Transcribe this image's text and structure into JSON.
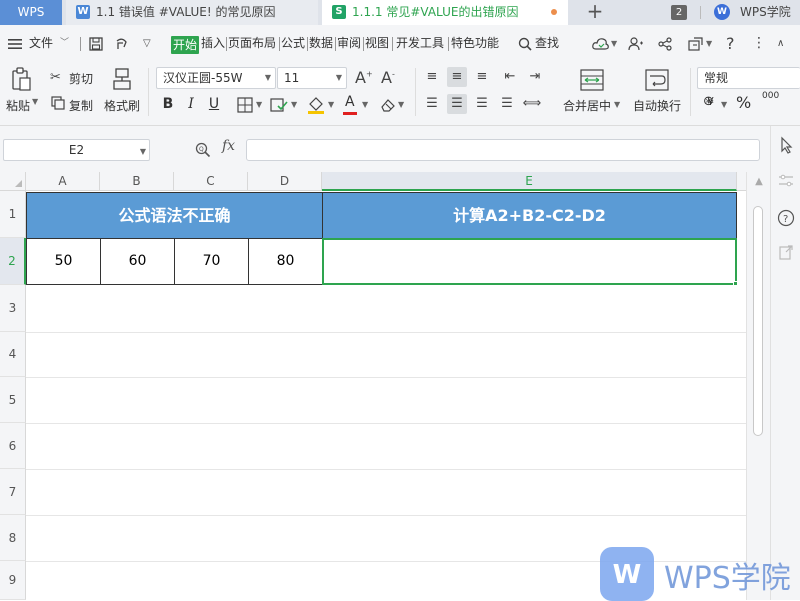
{
  "tabbar": {
    "brand": "WPS",
    "tabs": [
      {
        "label": "1.1 错误值 #VALUE! 的常见原因",
        "icon_letter": "W",
        "icon": "writer-doc-icon"
      },
      {
        "label": "1.1.1 常见#VALUE的出错原因",
        "icon_letter": "S",
        "icon": "spreadsheet-icon"
      }
    ],
    "plus": "+",
    "window_count": "2",
    "academy_logo": "W",
    "academy_label": "WPS学院"
  },
  "menubar": {
    "file": "文件",
    "items": [
      "开始",
      "插入",
      "页面布局",
      "公式",
      "数据",
      "审阅",
      "视图",
      "开发工具",
      "特色功能"
    ],
    "search": "查找",
    "help": "?"
  },
  "ribbon": {
    "paste": "粘贴",
    "cut": "剪切",
    "copy": "复制",
    "format_painter": "格式刷",
    "font_name": "汉仪正圆-55W",
    "font_size": "11",
    "bold": "B",
    "italic": "I",
    "underline": "U",
    "font_color_letter": "A",
    "merge_center": "合并居中",
    "wrap_text": "自动换行",
    "number_format": "常规",
    "currency": "¥",
    "percent": "%",
    "decimal": "000",
    "font_grow": "A",
    "font_shrink": "A"
  },
  "formula_bar": {
    "name_box": "E2",
    "fx": "fx",
    "formula": ""
  },
  "grid": {
    "columns": [
      "A",
      "B",
      "C",
      "D",
      "E"
    ],
    "selected_column": "E",
    "rows": [
      "1",
      "2",
      "3",
      "4",
      "5",
      "6",
      "7",
      "8",
      "9"
    ],
    "selected_row": "2",
    "header_left": "公式语法不正确",
    "header_right": "计算A2+B2-C2-D2",
    "values": [
      "50",
      "60",
      "70",
      "80"
    ],
    "e2_value": ""
  },
  "colors": {
    "accent_green": "#2ea44f",
    "header_blue": "#5b9bd5",
    "brand_blue": "#5b8fd6"
  },
  "watermark": {
    "logo_letter": "W",
    "text": "WPS学院"
  }
}
